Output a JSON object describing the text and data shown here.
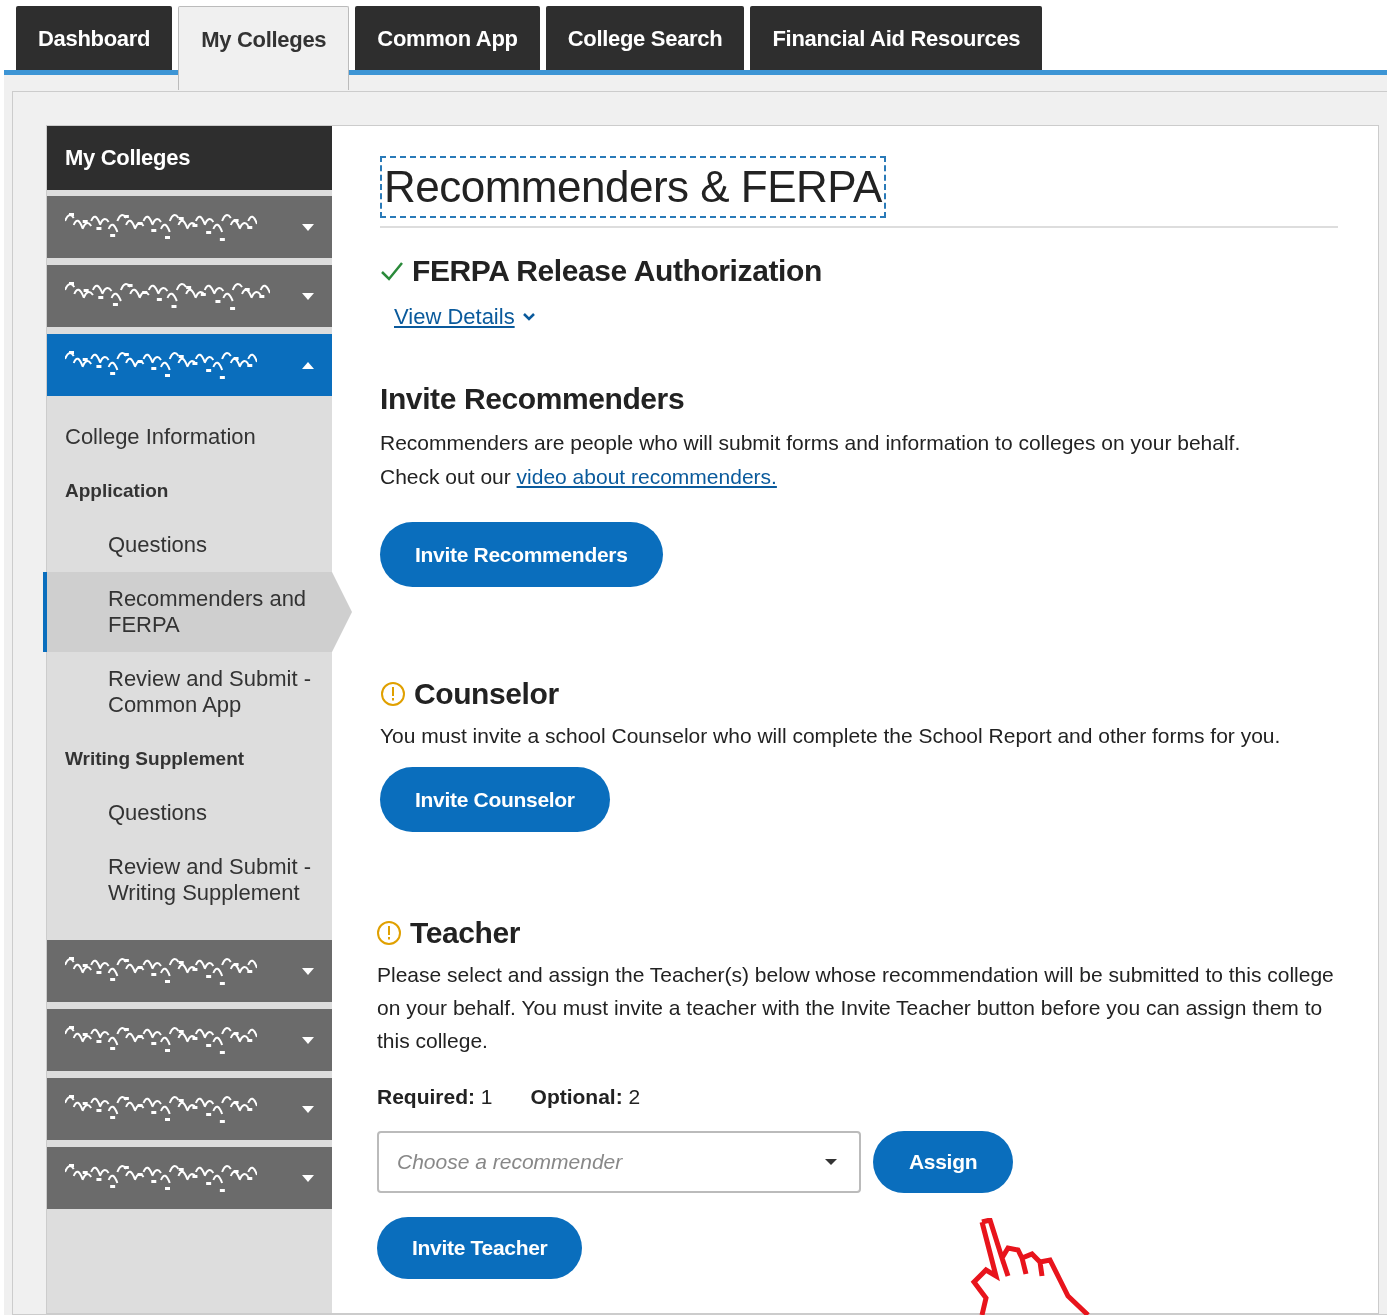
{
  "tabs": [
    {
      "label": "Dashboard",
      "selected": false
    },
    {
      "label": "My Colleges",
      "selected": true
    },
    {
      "label": "Common App",
      "selected": false
    },
    {
      "label": "College Search",
      "selected": false
    },
    {
      "label": "Financial Aid Resources",
      "selected": false
    }
  ],
  "sidebar": {
    "title": "My Colleges",
    "colleges_before": [
      {
        "expanded": false
      },
      {
        "expanded": false
      },
      {
        "expanded": true
      }
    ],
    "items": [
      {
        "kind": "link",
        "label": "College Information",
        "selected": false
      },
      {
        "kind": "heading",
        "label": "Application",
        "selected": false
      },
      {
        "kind": "sublink",
        "label": "Questions",
        "selected": false
      },
      {
        "kind": "sublink",
        "label": "Recommenders and FERPA",
        "selected": true
      },
      {
        "kind": "sublink",
        "label": "Review and Submit - Common App",
        "selected": false
      },
      {
        "kind": "heading",
        "label": "Writing Supplement",
        "selected": false
      },
      {
        "kind": "sublink",
        "label": "Questions",
        "selected": false
      },
      {
        "kind": "sublink",
        "label": "Review and Submit - Writing Supplement",
        "selected": false
      }
    ],
    "colleges_after": [
      {
        "expanded": false
      },
      {
        "expanded": false
      },
      {
        "expanded": false
      },
      {
        "expanded": false
      }
    ]
  },
  "main": {
    "title": "Recommenders & FERPA",
    "ferpa": {
      "title": "FERPA Release Authorization",
      "complete": true,
      "link": "View Details"
    },
    "invite": {
      "title": "Invite Recommenders",
      "text_lines": [
        "Recommenders are people who will submit forms and information to colleges on your behalf.",
        "Check out our "
      ],
      "link": "video about recommenders.",
      "button": "Invite Recommenders"
    },
    "counselor": {
      "title": "Counselor",
      "complete": false,
      "text": "You must invite a school Counselor who will complete the School Report and other forms for you.",
      "button": "Invite Counselor"
    },
    "teacher": {
      "title": "Teacher",
      "complete": false,
      "text": "Please select and assign the Teacher(s) below whose recommendation will be submitted to this college on your behalf. You must invite a teacher with the Invite Teacher button before you can assign them to this college.",
      "counts": [
        {
          "label": "Required:",
          "value": "1"
        },
        {
          "label": "Optional:",
          "value": "2"
        }
      ],
      "select_placeholder": "Choose a recommender",
      "assign_button": "Assign",
      "invite_button": "Invite Teacher"
    }
  }
}
